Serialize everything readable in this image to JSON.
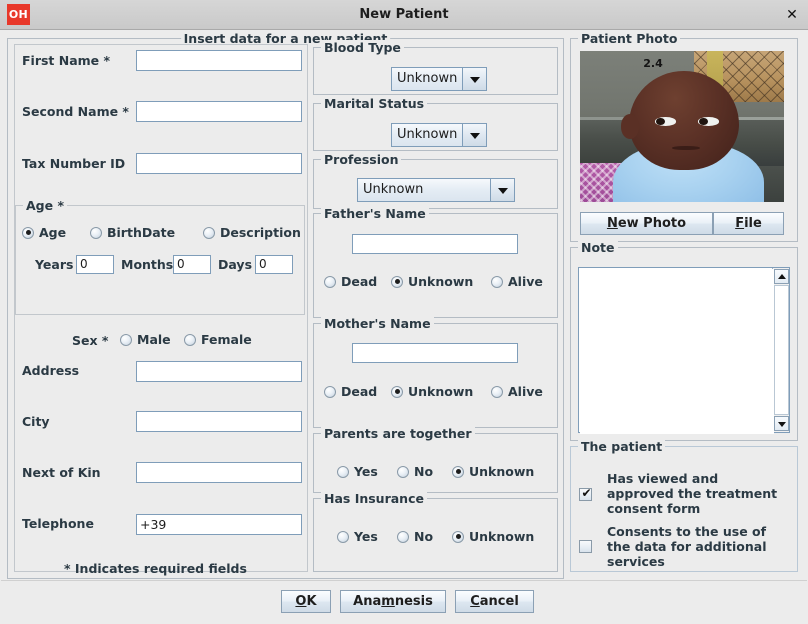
{
  "window": {
    "title": "New Patient",
    "logo_text": "OH",
    "close_icon": "✕",
    "accent_color": "#e8382a",
    "background_color": "#ececec",
    "border_color": "#b4bcc4"
  },
  "main_panel": {
    "title": "Insert data for a new patient"
  },
  "left": {
    "first_name": {
      "label": "First Name *",
      "value": "",
      "placeholder": ""
    },
    "second_name": {
      "label": "Second Name *",
      "value": "",
      "placeholder": ""
    },
    "tax_number": {
      "label": "Tax Number ID",
      "value": "",
      "placeholder": ""
    },
    "age_panel": {
      "title": "Age *",
      "options": [
        {
          "label": "Age",
          "selected": true
        },
        {
          "label": "BirthDate",
          "selected": false
        },
        {
          "label": "Description",
          "selected": false
        }
      ],
      "years": {
        "label": "Years",
        "value": "0"
      },
      "months": {
        "label": "Months",
        "value": "0"
      },
      "days": {
        "label": "Days",
        "value": "0"
      }
    },
    "sex": {
      "label": "Sex *",
      "options": [
        {
          "label": "Male",
          "selected": false
        },
        {
          "label": "Female",
          "selected": false
        }
      ]
    },
    "address": {
      "label": "Address",
      "value": ""
    },
    "city": {
      "label": "City",
      "value": ""
    },
    "next_of_kin": {
      "label": "Next of Kin",
      "value": ""
    },
    "telephone": {
      "label": "Telephone",
      "value": "+39"
    },
    "required_note": "* Indicates required fields"
  },
  "middle": {
    "blood_type": {
      "title": "Blood Type",
      "selected": "Unknown"
    },
    "marital_status": {
      "title": "Marital Status",
      "selected": "Unknown"
    },
    "profession": {
      "title": "Profession",
      "selected": "Unknown"
    },
    "father_name": {
      "title": "Father's Name",
      "value": "",
      "options": [
        {
          "label": "Dead",
          "selected": false
        },
        {
          "label": "Unknown",
          "selected": true
        },
        {
          "label": "Alive",
          "selected": false
        }
      ]
    },
    "mother_name": {
      "title": "Mother's Name",
      "value": "",
      "options": [
        {
          "label": "Dead",
          "selected": false
        },
        {
          "label": "Unknown",
          "selected": true
        },
        {
          "label": "Alive",
          "selected": false
        }
      ]
    },
    "parents_together": {
      "title": "Parents are together",
      "options": [
        {
          "label": "Yes",
          "selected": false
        },
        {
          "label": "No",
          "selected": false
        },
        {
          "label": "Unknown",
          "selected": true
        }
      ]
    },
    "has_insurance": {
      "title": "Has Insurance",
      "options": [
        {
          "label": "Yes",
          "selected": false
        },
        {
          "label": "No",
          "selected": false
        },
        {
          "label": "Unknown",
          "selected": true
        }
      ]
    }
  },
  "right": {
    "photo_panel": {
      "title": "Patient Photo",
      "overlay_number": "2.4",
      "new_photo_button": {
        "pre": "N",
        "post": "ew Photo"
      },
      "file_button": {
        "pre": "F",
        "post": "ile"
      }
    },
    "note_panel": {
      "title": "Note",
      "value": ""
    },
    "patient_panel": {
      "title": "The patient",
      "items": [
        {
          "label": "Has viewed and approved the treatment consent form",
          "checked": true
        },
        {
          "label": "Consents to the use of the data for additional services",
          "checked": false
        }
      ]
    }
  },
  "buttons": {
    "ok": {
      "pre": "O",
      "post": "K"
    },
    "anamnesis": {
      "a": "Ana",
      "mn": "m",
      "b": "nesis"
    },
    "cancel": {
      "pre": "C",
      "post": "ancel"
    }
  }
}
